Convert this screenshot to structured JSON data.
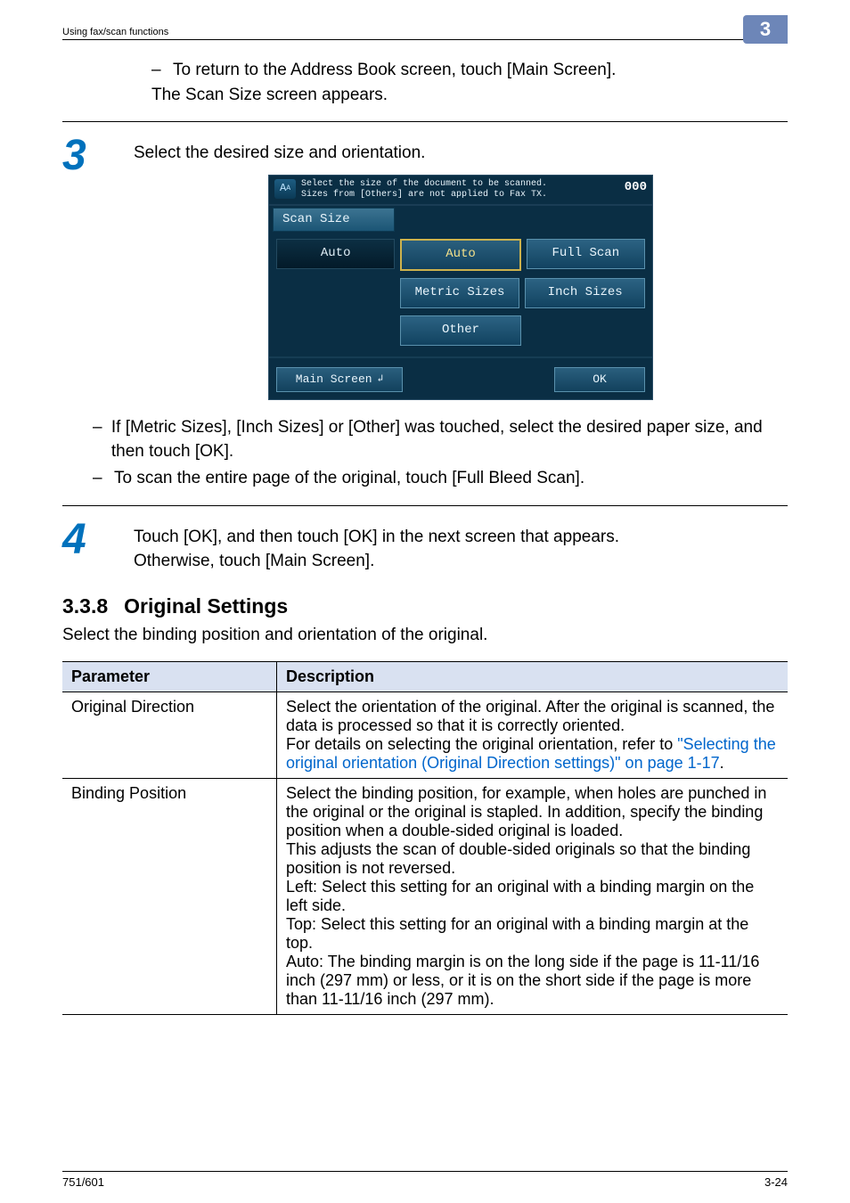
{
  "header": {
    "title": "Using fax/scan functions",
    "tab": "3"
  },
  "intro_block": {
    "line1_dash": "–",
    "line1": "To return to the Address Book screen, touch [Main Screen].",
    "line2": "The Scan Size screen appears."
  },
  "step3": {
    "num": "3",
    "text": "Select the desired size and orientation.",
    "device": {
      "top_icon": "A",
      "top_line1": "Select the size of the document to be scanned.",
      "top_line2": "Sizes from [Others] are not applied to Fax TX.",
      "top_right": "000",
      "tab": "Scan Size",
      "btn_auto_dark": "Auto",
      "btn_auto_sel": "Auto",
      "btn_full_scan": "Full Scan",
      "btn_metric": "Metric Sizes",
      "btn_inch": "Inch Sizes",
      "btn_other": "Other",
      "btn_main": "Main Screen",
      "btn_ok": "OK"
    },
    "bullets": [
      "If [Metric Sizes], [Inch Sizes] or [Other] was touched, select the desired paper size, and then touch [OK].",
      "To scan the entire page of the original, touch [Full Bleed Scan]."
    ]
  },
  "step4": {
    "num": "4",
    "line1": "Touch [OK], and then touch [OK] in the next screen that appears.",
    "line2": "Otherwise, touch [Main Screen]."
  },
  "section": {
    "num": "3.3.8",
    "title": "Original Settings",
    "intro": "Select the binding position and orientation of the original."
  },
  "table": {
    "head_param": "Parameter",
    "head_desc": "Description",
    "rows": [
      {
        "param": "Original Direction",
        "desc_pre": "Select the orientation of the original. After the original is scanned, the data is processed so that it is correctly oriented.\nFor details on selecting the original orientation, refer to ",
        "desc_link": "\"Selecting the original orientation (Original Direction settings)\" on page 1-17",
        "desc_post": "."
      },
      {
        "param": "Binding Position",
        "desc_pre": "Select the binding position, for example, when holes are punched in the original or the original is stapled. In addition, specify the binding position when a double-sided original is loaded.\nThis adjusts the scan of double-sided originals so that the binding position is not reversed.\nLeft: Select this setting for an original with a binding margin on the left side.\nTop: Select this setting for an original with a binding margin at the top.\nAuto: The binding margin is on the long side if the page is 11-11/16 inch (297 mm) or less, or it is on the short side if the page is more than 11-11/16 inch (297 mm).",
        "desc_link": "",
        "desc_post": ""
      }
    ]
  },
  "footer": {
    "left": "751/601",
    "right": "3-24"
  }
}
